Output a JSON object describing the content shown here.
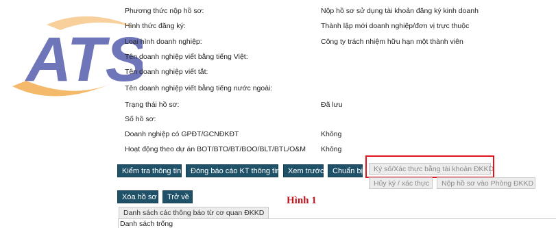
{
  "rows": [
    {
      "label": "Phương thức nộp hồ sơ:",
      "value": "Nộp hồ sơ sử dụng tài khoản đăng ký kinh doanh"
    },
    {
      "label": "Hình thức đăng ký:",
      "value": "Thành lập mới doanh nghiệp/đơn vị trực thuộc"
    },
    {
      "label": "Loại hình doanh nghiệp:",
      "value": "Công ty trách nhiệm hữu hạn một thành viên"
    },
    {
      "label": "Tên doanh nghiệp viết bằng tiếng Việt:",
      "value": ""
    },
    {
      "label": "Tên doanh nghiệp viết tắt:",
      "value": ""
    },
    {
      "label": "Tên doanh nghiệp viết bằng tiếng nước ngoài:",
      "value": ""
    },
    {
      "label": "Trạng thái hồ sơ:",
      "value": "Đã lưu"
    },
    {
      "label": "Số hồ sơ:",
      "value": ""
    },
    {
      "label": "Doanh nghiệp có GPĐT/GCNĐKĐT",
      "value": "Không"
    },
    {
      "label": "Hoạt động theo dự án BOT/BTO/BT/BOO/BLT/BTL/O&M",
      "value": "Không"
    }
  ],
  "buttons": {
    "check": "Kiểm tra thông tin",
    "report": "Đóng báo cáo KT thông tin",
    "preview": "Xem trước",
    "prepare": "Chuẩn bị",
    "sign": "Ký số/Xác thực bằng tài khoản ĐKKD",
    "cancel_sign": "Hủy ký / xác thực",
    "submit": "Nộp hồ sơ vào Phòng ĐKKD",
    "delete": "Xóa hồ sơ",
    "back": "Trở về"
  },
  "figure_label": "Hình 1",
  "tab_label": "Danh sách các thông báo từ cơ quan ĐKKD",
  "empty_list": "Danh sách trống",
  "logo": {
    "text": "ATS",
    "color": "#4a53a8",
    "swoosh_color": "#f2a23a"
  }
}
